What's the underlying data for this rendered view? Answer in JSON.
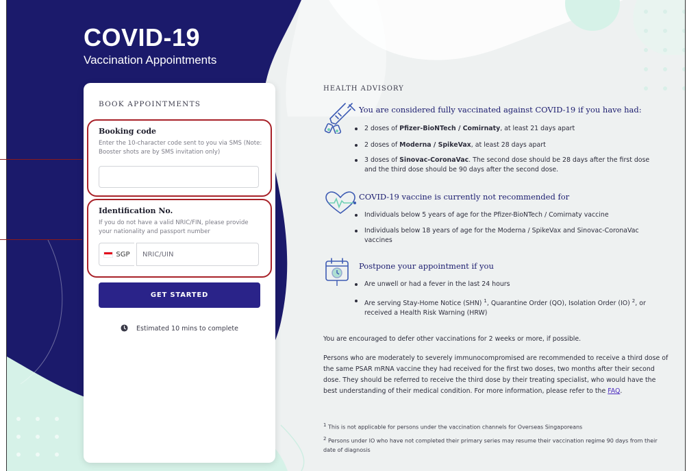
{
  "brand": {
    "title": "COVID-19",
    "subtitle": "Vaccination Appointments"
  },
  "booking": {
    "heading": "BOOK APPOINTMENTS",
    "code_label": "Booking code",
    "code_help": "Enter the 10-character code sent to you via SMS (Note: Booster shots are by SMS invitation only)",
    "code_value": "",
    "id_label": "Identification No.",
    "id_help": "If you do not have a valid NRIC/FIN, please provide your nationality and passport number",
    "country_code": "SGP",
    "id_placeholder": "NRIC/UIN",
    "cta_label": "GET STARTED",
    "estimate": "Estimated 10 mins to complete"
  },
  "advisory": {
    "title": "HEALTH ADVISORY",
    "sections": [
      {
        "icon": "vaccine-icon",
        "heading": "You are considered fully vaccinated against COVID-19 if you have had:",
        "bullets": [
          {
            "pre": "2 doses of ",
            "bold": "Pfizer-BioNTech / Comirnaty",
            "post": ", at least 21 days apart"
          },
          {
            "pre": "2 doses of ",
            "bold": "Moderna / SpikeVax",
            "post": ", at least 28 days apart"
          },
          {
            "pre": "3 doses of ",
            "bold": "Sinovac-CoronaVac",
            "post": ". The second dose should be 28 days after the first dose and the third dose should be 90 days after the second dose."
          }
        ]
      },
      {
        "icon": "heart-icon",
        "heading": "COVID-19 vaccine is currently not recommended for",
        "bullets": [
          {
            "text": "Individuals below 5 years of age for the Pfizer-BioNTech / Comirnaty vaccine"
          },
          {
            "text": "Individuals below 18 years of age for the Moderna / SpikeVax and Sinovac-CoronaVac vaccines"
          }
        ]
      },
      {
        "icon": "calendar-icon",
        "heading": "Postpone your appointment if you",
        "bullets": [
          {
            "text": "Are unwell or had a fever in the last 24 hours"
          },
          {
            "a": "Are serving Stay-Home Notice (SHN) ",
            "sup1": "1",
            "b": ", Quarantine Order (QO), Isolation Order (IO) ",
            "sup2": "2",
            "c": ", or received a Health Risk Warning (HRW)"
          }
        ]
      }
    ],
    "defer_text": "You are encouraged to defer other vaccinations for 2 weeks or more, if possible.",
    "immuno_text": "Persons who are moderately to severely immunocompromised are recommended to receive a third dose of the same PSAR mRNA vaccine they had received for the first two doses, two months after their second dose. They should be referred to receive the third dose by their treating specialist, who would have the best understanding of their medical condition. For more information, please refer to the ",
    "faq_link": "FAQ",
    "immuno_end": ".",
    "footnotes": [
      {
        "num": "1",
        "text": " This is not applicable for persons under the vaccination channels for Overseas Singaporeans"
      },
      {
        "num": "2",
        "text": " Persons under IO who have not completed their primary series may resume their vaccination regime 90 days from their date of diagnosis"
      }
    ]
  },
  "colors": {
    "navy": "#1b1a6b",
    "mint": "#d6f2e8",
    "accent": "#2a2389",
    "highlight": "#a82128"
  }
}
